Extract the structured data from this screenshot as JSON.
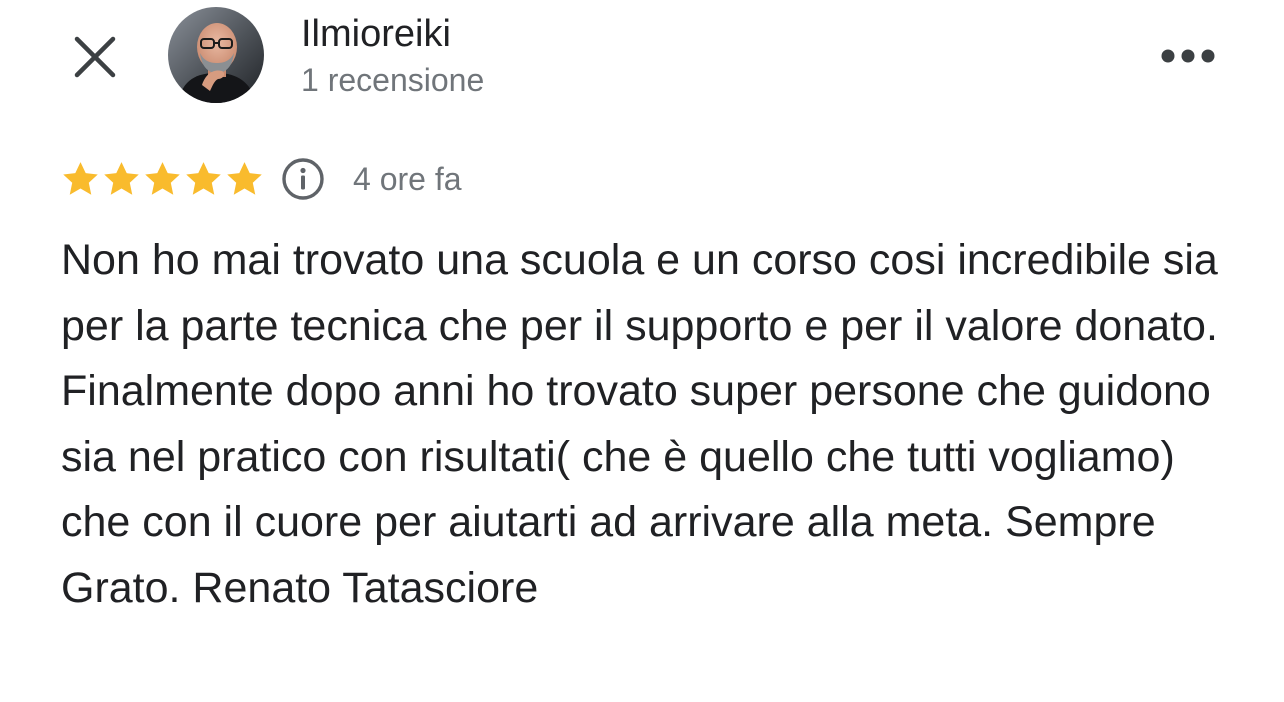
{
  "header": {
    "close_icon": "close-icon",
    "author_name": "Ilmioreiki",
    "review_count": "1 recensione",
    "more_icon": "more-horizontal-icon"
  },
  "rating": {
    "stars": 5,
    "max_stars": 5,
    "star_color": "#f9bb2d",
    "info_icon": "info-icon",
    "time_ago": "4 ore fa"
  },
  "review": {
    "text": "Non ho mai trovato una scuola e un corso cosi incredibile sia per la parte tecnica che per il supporto e per il valore donato. Finalmente dopo anni ho trovato super persone che guidono sia nel pratico con risultati( che è quello che tutti vogliamo) che con il cuore per aiutarti ad arrivare alla meta. Sempre Grato. Renato Tatasciore"
  },
  "colors": {
    "primary_text": "#202124",
    "secondary_text": "#70757a",
    "icon": "#3c4043",
    "star": "#f9bb2d"
  }
}
